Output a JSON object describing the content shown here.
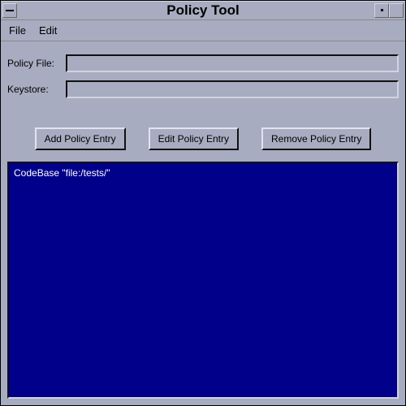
{
  "window": {
    "title": "Policy Tool"
  },
  "menubar": {
    "file": "File",
    "edit": "Edit"
  },
  "fields": {
    "policy_file": {
      "label": "Policy File:",
      "value": ""
    },
    "keystore": {
      "label": "Keystore:",
      "value": ""
    }
  },
  "buttons": {
    "add": "Add Policy Entry",
    "edit": "Edit Policy Entry",
    "remove": "Remove Policy Entry"
  },
  "list": {
    "items": [
      "CodeBase \"file:/tests/\""
    ]
  }
}
